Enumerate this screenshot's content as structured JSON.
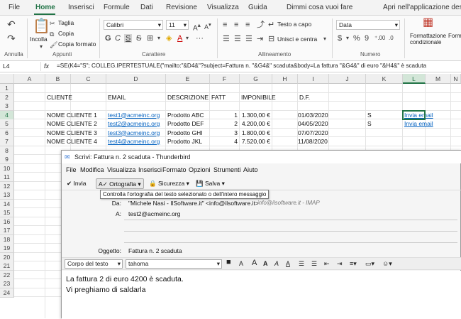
{
  "tabs": [
    "File",
    "Home",
    "Inserisci",
    "Formule",
    "Dati",
    "Revisione",
    "Visualizza",
    "Guida",
    "Dimmi cosa vuoi fare",
    "Apri nell'applicazione desktop"
  ],
  "ribbon": {
    "annulla": "Annulla",
    "incolla": "Incolla",
    "taglia": "Taglia",
    "copia": "Copia",
    "copia_formato": "Copia formato",
    "appunti": "Appunti",
    "font_name": "Calibri",
    "font_size": "11",
    "carattere": "Carattere",
    "testo_a_capo": "Testo a capo",
    "unisci": "Unisci e centra",
    "allineamento": "Allineamento",
    "number_format": "Data",
    "numero": "Numero",
    "formattazione": "Formattazione condizionale",
    "form_short": "Form"
  },
  "formula_bar": {
    "name": "L4",
    "fx": "fx",
    "formula": "=SE(K4=\"S\"; COLLEG.IPERTESTUALE(\"mailto:\"&D4&\"?subject=Fattura n. \"&G4&\" scaduta&body=La fattura \"&G4&\" di euro \"&H4&\" è scaduta"
  },
  "columns": [
    "A",
    "B",
    "C",
    "D",
    "E",
    "F",
    "G",
    "H",
    "I",
    "J",
    "K",
    "L",
    "M",
    "N"
  ],
  "rows": [
    "1",
    "2",
    "3",
    "4",
    "5",
    "6",
    "7",
    "8",
    "9",
    "10",
    "11",
    "12",
    "13",
    "14",
    "15",
    "16",
    "17",
    "18",
    "19",
    "20",
    "21",
    "22",
    "23",
    "24"
  ],
  "headers": {
    "cliente": "CLIENTE",
    "email": "EMAIL",
    "descrizione": "DESCRIZIONE",
    "fatt": "FATT",
    "imponibile": "IMPONIBILE",
    "df": "D.F."
  },
  "data_rows": [
    {
      "cliente": "NOME CLIENTE 1",
      "email": "test1@acmeinc.org",
      "descrizione": "Prodotto ABC",
      "fatt": "1",
      "imponibile": "1.300,00 €",
      "df": "01/03/2020",
      "flag": "S",
      "link": "Invia email"
    },
    {
      "cliente": "NOME CLIENTE 2",
      "email": "test2@acmeinc.org",
      "descrizione": "Prodotto DEF",
      "fatt": "2",
      "imponibile": "4.200,00 €",
      "df": "04/05/2020",
      "flag": "S",
      "link": "Invia email"
    },
    {
      "cliente": "NOME CLIENTE 3",
      "email": "test3@acmeinc.org",
      "descrizione": "Prodotto GHI",
      "fatt": "3",
      "imponibile": "1.800,00 €",
      "df": "07/07/2020",
      "flag": "",
      "link": ""
    },
    {
      "cliente": "NOME CLIENTE 4",
      "email": "test4@acmeinc.org",
      "descrizione": "Prodotto JKL",
      "fatt": "4",
      "imponibile": "7.520,00 €",
      "df": "11/08/2020",
      "flag": "",
      "link": ""
    }
  ],
  "thunderbird": {
    "title": "Scrivi: Fattura n. 2 scaduta - Thunderbird",
    "menu": [
      "File",
      "Modifica",
      "Visualizza",
      "Inserisci",
      "Formato",
      "Opzioni",
      "Strumenti",
      "Aiuto"
    ],
    "toolbar": {
      "invia": "Invia",
      "ortografia": "Ortografia",
      "sicurezza": "Sicurezza",
      "salva": "Salva"
    },
    "tooltip": "Controlla l'ortografia del testo selezionato o dell'intero messaggio",
    "da_label": "Da:",
    "da_value": "\"Michele Nasi - IlSoftware.it\" <info@ilsoftware.it>",
    "da_account": "info@ilsoftware.it - IMAP",
    "a_label": "A:",
    "a_value": "test2@acmeinc.org",
    "oggetto_label": "Oggetto:",
    "oggetto_value": "Fattura n. 2 scaduta",
    "paragraph_style": "Corpo del testo",
    "font": "tahoma",
    "body": [
      "La fattura 2 di euro 4200 è scaduta.",
      "Vi preghiamo di saldarla"
    ]
  },
  "colors": {
    "accent": "#217346",
    "link": "#0563c1"
  }
}
